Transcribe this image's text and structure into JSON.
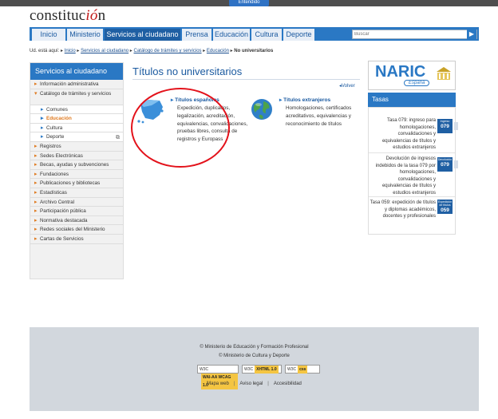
{
  "top_notice": {
    "button_label": "Entendido"
  },
  "logo": {
    "text_before": "constitu",
    "text_c": "c",
    "text_accent": "i",
    "text_o": "ó",
    "text_after": "n"
  },
  "nav": {
    "tabs": [
      "Inicio",
      "Ministerio",
      "Servicios al ciudadano",
      "Prensa",
      "Educación",
      "Cultura",
      "Deporte"
    ],
    "active_tab": "Servicios al ciudadano",
    "search_placeholder": "Buscar"
  },
  "breadcrumb": {
    "prefix": "Ud. está aquí:",
    "items": [
      "Inicio",
      "Servicios al ciudadano",
      "Catálogo de trámites y servicios",
      "Educación"
    ],
    "current": "No universitarios"
  },
  "sidebar": {
    "title": "Servicios al ciudadano",
    "items": [
      {
        "label": "Información administrativa",
        "level": 0
      },
      {
        "label": "Catálogo de trámites y servicios",
        "level": 0,
        "open": true
      },
      {
        "label": "Comunes",
        "level": 1
      },
      {
        "label": "Educación",
        "level": 1,
        "current": true
      },
      {
        "label": "Cultura",
        "level": 1
      },
      {
        "label": "Deporte",
        "level": 1,
        "external": true
      },
      {
        "label": "Registros",
        "level": 0
      },
      {
        "label": "Sedes Electrónicas",
        "level": 0
      },
      {
        "label": "Becas, ayudas y subvenciones",
        "level": 0
      },
      {
        "label": "Fundaciones",
        "level": 0
      },
      {
        "label": "Publicaciones y bibliotecas",
        "level": 0
      },
      {
        "label": "Estadísticas",
        "level": 0
      },
      {
        "label": "Archivo Central",
        "level": 0
      },
      {
        "label": "Participación pública",
        "level": 0
      },
      {
        "label": "Normativa destacada",
        "level": 0
      },
      {
        "label": "Redes sociales del Ministerio",
        "level": 0
      },
      {
        "label": "Cartas de Servicios",
        "level": 0
      }
    ]
  },
  "main": {
    "title": "Títulos no universitarios",
    "back_link": "Volver",
    "cards": [
      {
        "title": "Títulos españoles",
        "description": "Expedición, duplicados, legalización, acreditación, equivalencias, convalidaciones, pruebas libres, consulta de registros y Europass",
        "icon": "spain-map-icon"
      },
      {
        "title": "Títulos extranjeros",
        "description": "Homologaciones, certificados acreditativos, equivalencias y reconocimiento de títulos",
        "icon": "globe-icon"
      }
    ]
  },
  "naric": {
    "title": "NARIC",
    "subtitle": "España"
  },
  "tasas": {
    "title": "Tasas",
    "items": [
      {
        "text": "Tasa 079: ingreso para homologaciones, convalidaciones y equivalencias de títulos y estudios extranjeros",
        "badge_top": "Ingreso",
        "badge_num": "079"
      },
      {
        "text": "Devolución de ingresos indebidos de la tasa 079 por homologaciones, convalidaciones y equivalencias de títulos y estudios extranjeros",
        "badge_top": "Devolución",
        "badge_num": "079"
      },
      {
        "text": "Tasa 059: expedición de títulos y diplomas académicos, docentes y profesionales",
        "badge_top": "Expedición de títulos",
        "badge_num": "059"
      }
    ]
  },
  "footer": {
    "line1": "© Ministerio de Educación y Formación Profesional",
    "line2": "© Ministerio de Cultura y Deporte",
    "badges": [
      {
        "prefix": "W3C",
        "tag": "WAI-AA WCAG 1.0"
      },
      {
        "prefix": "W3C",
        "tag": "XHTML 1.0"
      },
      {
        "prefix": "W3C",
        "tag": "css"
      }
    ],
    "links": [
      "Mapa web",
      "Aviso legal",
      "Accesibilidad"
    ]
  },
  "colors": {
    "brand_blue": "#2a78c4",
    "accent_orange": "#e07a20",
    "highlight_red": "#e3121b"
  }
}
